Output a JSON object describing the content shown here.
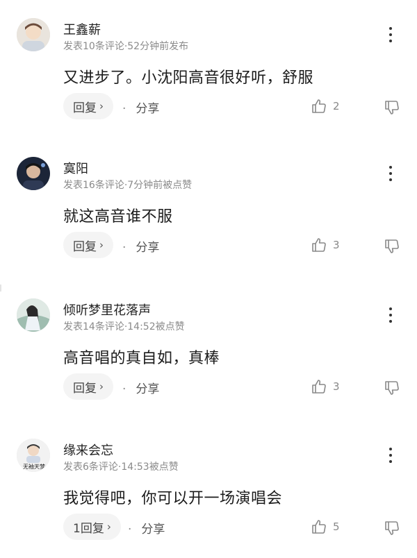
{
  "colors": {
    "text": "#1b1b1b",
    "meta": "#8a8a8a",
    "pill": "#f4f4f4",
    "icon": "#888888"
  },
  "comments": [
    {
      "username": "王鑫薪",
      "meta": "发表10条评论·52分钟前发布",
      "text": "又进步了。小沈阳高音很好听，舒服",
      "reply_label": "回复",
      "share_label": "分享",
      "likes": "2"
    },
    {
      "username": "寞阳",
      "meta": "发表16条评论·7分钟前被点赞",
      "text": "就这高音谁不服",
      "reply_label": "回复",
      "share_label": "分享",
      "likes": "3"
    },
    {
      "username": "倾听梦里花落声",
      "meta": "发表14条评论·14:52被点赞",
      "text": "高音唱的真自如，真棒",
      "reply_label": "回复",
      "share_label": "分享",
      "likes": "3"
    },
    {
      "username": "缘来会忘",
      "meta": "发表6条评论·14:53被点赞",
      "text": "我觉得吧，你可以开一场演唱会",
      "reply_label": "1回复",
      "share_label": "分享",
      "likes": "5",
      "avatar_text": "无袖天梦"
    }
  ],
  "icons": {
    "chevron": "chevron-right-icon",
    "like": "thumbs-up-icon",
    "dislike": "thumbs-down-icon",
    "more": "more-vertical-icon"
  }
}
